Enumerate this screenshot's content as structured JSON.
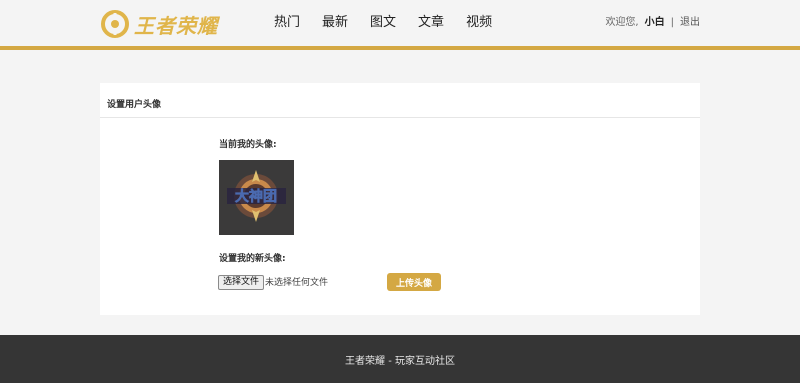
{
  "brand": {
    "logo_text": "王者荣耀",
    "accent_color": "#d4a843"
  },
  "nav": {
    "items": [
      {
        "label": "热门"
      },
      {
        "label": "最新"
      },
      {
        "label": "图文"
      },
      {
        "label": "文章"
      },
      {
        "label": "视频"
      }
    ]
  },
  "user": {
    "greeting": "欢迎您,",
    "name": "小白",
    "separator": "|",
    "logout": "退出"
  },
  "panel": {
    "title": "设置用户头像",
    "current_label": "当前我的头像:",
    "avatar_icon": "avatar-image",
    "avatar_text": "大神团",
    "new_label": "设置我的新头像:",
    "file_button": "选择文件",
    "file_status": "未选择任何文件",
    "upload_button": "上传头像"
  },
  "footer": {
    "text": "王者荣耀 - 玩家互动社区"
  }
}
